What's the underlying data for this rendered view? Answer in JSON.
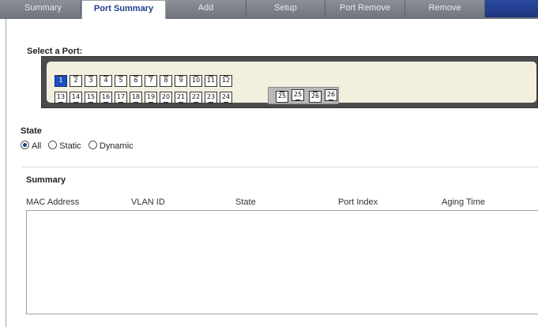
{
  "tabs": [
    {
      "label": "Summary",
      "active": false
    },
    {
      "label": "Port Summary",
      "active": true
    },
    {
      "label": "Add",
      "active": false
    },
    {
      "label": "Setup",
      "active": false
    },
    {
      "label": "Port Remove",
      "active": false
    },
    {
      "label": "Remove",
      "active": false
    }
  ],
  "select_port": {
    "title": "Select a Port:",
    "selected_port": "1",
    "top_row": [
      "1",
      "2",
      "3",
      "4",
      "5",
      "6",
      "7",
      "8",
      "9",
      "10",
      "11",
      "12"
    ],
    "bottom_row": [
      "13",
      "14",
      "15",
      "16",
      "17",
      "18",
      "19",
      "20",
      "21",
      "22",
      "23",
      "24"
    ],
    "sfp_row": [
      "25",
      "25",
      "26",
      "26"
    ]
  },
  "state": {
    "title": "State",
    "options": [
      "All",
      "Static",
      "Dynamic"
    ],
    "selected": "All"
  },
  "summary": {
    "title": "Summary",
    "columns": [
      "MAC Address",
      "VLAN ID",
      "State",
      "Port Index",
      "Aging Time"
    ],
    "rows": []
  },
  "colors": {
    "tab_bar": "#7d828a",
    "active_tab_text": "#1e3f8a",
    "selected_port": "#1c4fc4",
    "port_panel": "#4b4b4b",
    "port_panel_inner": "#f3efdf"
  }
}
